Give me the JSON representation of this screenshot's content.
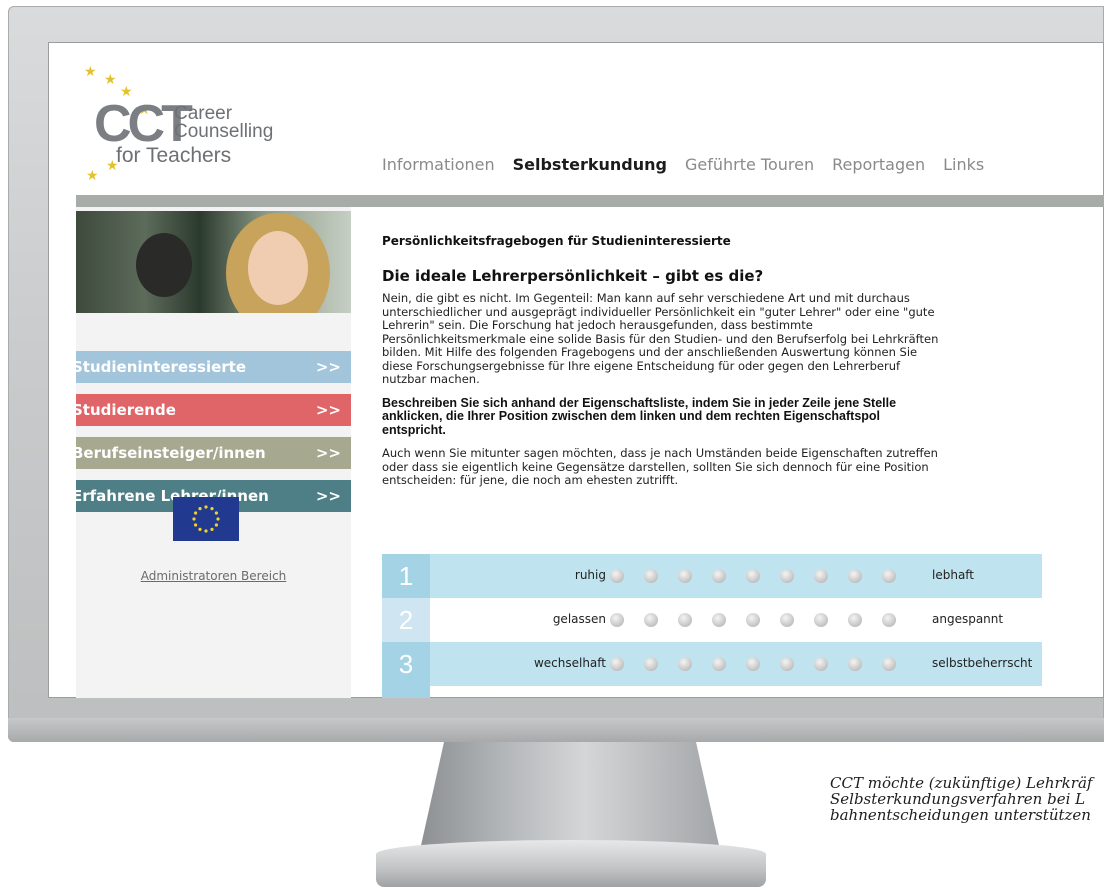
{
  "logo": {
    "abbr": "CCT",
    "line1": "Career",
    "line2": "Counselling",
    "line3": "for Teachers",
    "star_color": "#e2c32f"
  },
  "nav": {
    "items": [
      {
        "label": "Informationen",
        "active": false
      },
      {
        "label": "Selbsterkundung",
        "active": true
      },
      {
        "label": "Geführte Touren",
        "active": false
      },
      {
        "label": "Reportagen",
        "active": false
      },
      {
        "label": "Links",
        "active": false
      }
    ]
  },
  "sidebar": {
    "buttons": [
      {
        "label": "Studieninteressierte",
        "arrow": ">>",
        "color": "#a3c5dc"
      },
      {
        "label": "Studierende",
        "arrow": ">>",
        "color": "#e06568"
      },
      {
        "label": "Berufseinsteiger/innen",
        "arrow": ">>",
        "color": "#a6a890"
      },
      {
        "label": "Erfahrene Lehrer/innen",
        "arrow": ">>",
        "color": "#4f7f86"
      }
    ],
    "eu_flag_icon": "eu-flag-icon",
    "admin_link": "Administratoren Bereich"
  },
  "main": {
    "page_heading": "Persönlichkeitsfragebogen für Studieninteressierte",
    "section_heading": "Die ideale Lehrerpersönlichkeit – gibt es die?",
    "intro_lines": [
      "Nein, die gibt es nicht. Im Gegenteil: Man kann auf sehr verschiedene Art und mit durchaus",
      "unterschiedlicher und ausgeprägt individueller Persönlichkeit ein \"guter Lehrer\" oder eine \"gute",
      "Lehrerin\" sein. Die Forschung hat jedoch herausgefunden, dass bestimmte",
      "Persönlichkeitsmerkmale eine solide Basis für den Studien- und den Berufserfolg bei Lehrkräften",
      "bilden. Mit Hilfe des folgenden Fragebogens und der anschließenden Auswertung können Sie",
      "diese Forschungsergebnisse für Ihre eigene Entscheidung für oder gegen den Lehrerberuf",
      "nutzbar machen."
    ],
    "instruction_lines": [
      "Beschreiben Sie sich anhand der Eigenschaftsliste, indem Sie in jeder Zeile jene Stelle",
      "anklicken, die Ihrer Position zwischen dem linken und dem rechten Eigenschaftspol",
      "entspricht."
    ],
    "note_lines": [
      "Auch wenn Sie mitunter sagen möchten, dass je nach Umständen beide Eigenschaften zutreffen",
      "oder dass sie eigentlich keine Gegensätze darstellen, sollten Sie sich dennoch für eine Position",
      "entscheiden: für jene, die noch am ehesten zutrifft."
    ]
  },
  "questionnaire": {
    "scale_points": 9,
    "items": [
      {
        "number": "1",
        "left": "ruhig",
        "right": "lebhaft",
        "shaded": true
      },
      {
        "number": "2",
        "left": "gelassen",
        "right": "angespannt",
        "shaded": false
      },
      {
        "number": "3",
        "left": "wechselhaft",
        "right": "selbstbeherrscht",
        "shaded": true
      }
    ]
  },
  "caption": {
    "lines": [
      "CCT möchte (zukünftige) Lehrkräf",
      "Selbsterkundungsverfahren bei L",
      "bahnentscheidungen unterstützen"
    ]
  }
}
